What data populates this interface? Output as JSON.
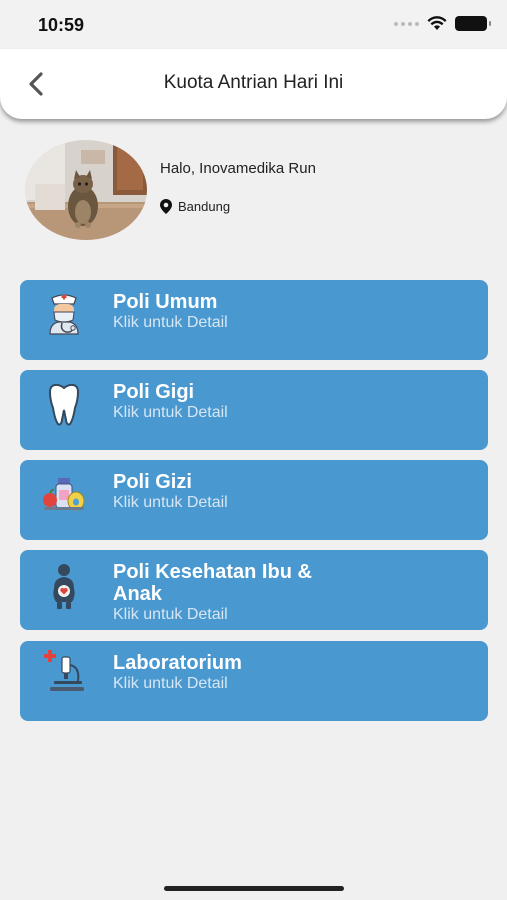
{
  "status_bar": {
    "time": "10:59"
  },
  "header": {
    "title": "Kuota Antrian Hari Ini",
    "back_icon": "chevron-left-icon"
  },
  "profile": {
    "greeting": "Halo, Inovamedika Run",
    "location": "Bandung",
    "avatar_icon": "cat-photo"
  },
  "menu": [
    {
      "title": "Poli Umum",
      "subtitle": "Klik untuk Detail",
      "icon": "doctor-icon"
    },
    {
      "title": "Poli Gigi",
      "subtitle": "Klik untuk Detail",
      "icon": "tooth-icon"
    },
    {
      "title": "Poli Gizi",
      "subtitle": "Klik untuk Detail",
      "icon": "nutrition-icon"
    },
    {
      "title": "Poli Kesehatan Ibu &",
      "title_line2": "Anak",
      "subtitle": "Klik untuk Detail",
      "icon": "pregnant-mother-icon"
    },
    {
      "title": "Laboratorium",
      "subtitle": "Klik untuk Detail",
      "icon": "microscope-icon"
    }
  ],
  "colors": {
    "card": "#4a98d0",
    "background": "#f0f0f0"
  }
}
